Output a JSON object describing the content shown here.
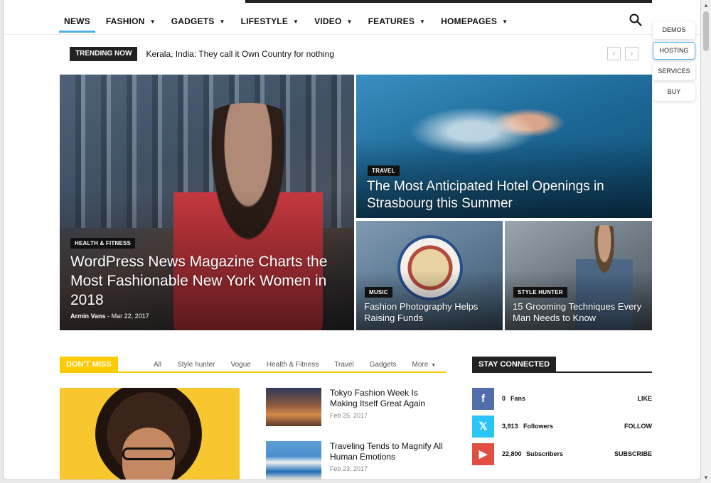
{
  "nav": {
    "items": [
      {
        "label": "NEWS",
        "chevron": false,
        "active": true
      },
      {
        "label": "FASHION",
        "chevron": true
      },
      {
        "label": "GADGETS",
        "chevron": true
      },
      {
        "label": "LIFESTYLE",
        "chevron": true
      },
      {
        "label": "VIDEO",
        "chevron": true
      },
      {
        "label": "FEATURES",
        "chevron": true
      },
      {
        "label": "HOMEPAGES",
        "chevron": true
      }
    ],
    "search_icon": "search-icon",
    "accent_color": "#4db2ec"
  },
  "side_buttons": [
    "DEMOS",
    "HOSTING",
    "SERVICES",
    "BUY"
  ],
  "trending": {
    "label": "TRENDING NOW",
    "text": "Kerala, India: They call it Own Country for nothing",
    "prev": "‹",
    "next": "›"
  },
  "hero": {
    "main": {
      "category": "HEALTH & FITNESS",
      "title": "WordPress News Magazine Charts the Most Fashionable New York Women in 2018",
      "author": "Armin Vans",
      "separator": "-",
      "date": "Mar 22, 2017"
    },
    "travel": {
      "category": "TRAVEL",
      "title": "The Most Anticipated Hotel Openings in Strasbourg this Summer"
    },
    "music": {
      "category": "MUSIC",
      "title": "Fashion Photography Helps Raising Funds"
    },
    "style": {
      "category": "STYLE HUNTER",
      "title": "15 Grooming Techniques Every Man Needs to Know"
    }
  },
  "dont_miss": {
    "label": "DON'T MISS",
    "tabs": [
      "All",
      "Style hunter",
      "Vogue",
      "Health & Fitness",
      "Travel",
      "Gadgets"
    ],
    "more": "More",
    "accent_color": "#ffca00",
    "items": [
      {
        "title": "Tokyo Fashion Week Is Making Itself Great Again",
        "date": "Feb 25, 2017"
      },
      {
        "title": "Traveling Tends to Magnify All Human Emotions",
        "date": "Feb 23, 2017"
      }
    ]
  },
  "stay_connected": {
    "label": "STAY CONNECTED",
    "rows": [
      {
        "icon": "facebook-icon",
        "glyph": "f",
        "count": "0",
        "unit": "Fans",
        "action": "LIKE",
        "color": "#516eab"
      },
      {
        "icon": "x-icon",
        "glyph": "𝕏",
        "count": "3,913",
        "unit": "Followers",
        "action": "FOLLOW",
        "color": "#29c5f6"
      },
      {
        "icon": "youtube-icon",
        "glyph": "▶",
        "count": "22,800",
        "unit": "Subscribers",
        "action": "SUBSCRIBE",
        "color": "#e14e42"
      }
    ]
  }
}
